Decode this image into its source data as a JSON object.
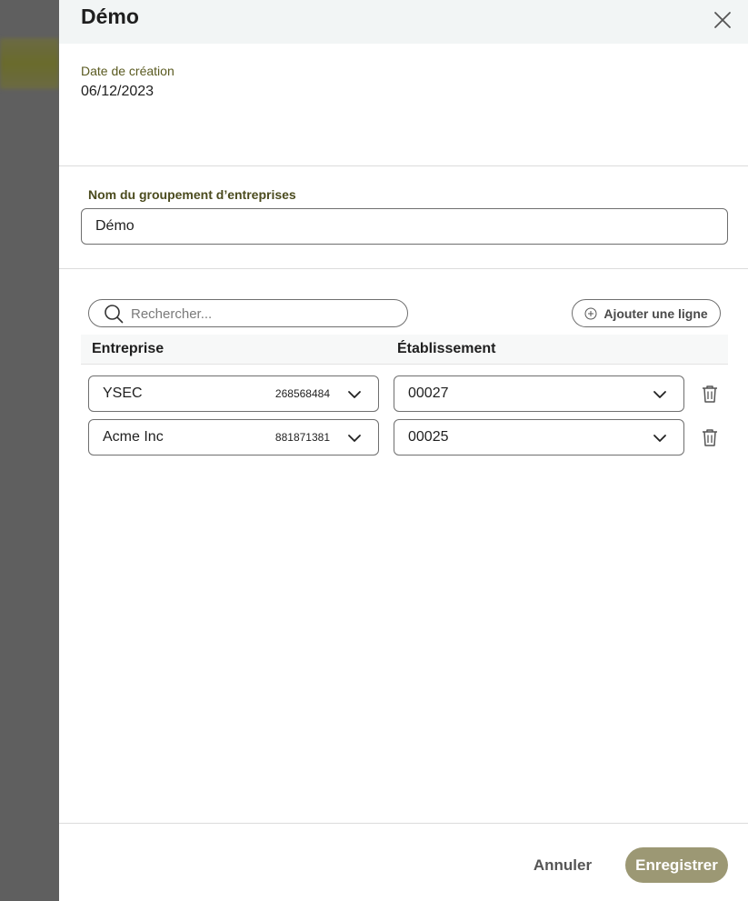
{
  "drawer": {
    "title": "Démo",
    "creation_label": "Date de création",
    "creation_date": "06/12/2023"
  },
  "name_field": {
    "label": "Nom du groupement d’entreprises",
    "value": "Démo"
  },
  "search": {
    "placeholder": "Rechercher..."
  },
  "add_line_label": "Ajouter une ligne",
  "table": {
    "headers": [
      "Entreprise",
      "Établissement"
    ],
    "rows": [
      {
        "company": "YSEC",
        "siren": "268568484",
        "establishment": "00027"
      },
      {
        "company": "Acme Inc",
        "siren": "881871381",
        "establishment": "00025"
      }
    ]
  },
  "footer": {
    "cancel_label": "Annuler",
    "save_label": "Enregistrer"
  },
  "colors": {
    "accent": "#9c9874",
    "label": "#5a5a20"
  },
  "icons": [
    "close-icon",
    "search-icon",
    "plus-circle-icon",
    "chevron-down-icon",
    "trash-icon"
  ]
}
